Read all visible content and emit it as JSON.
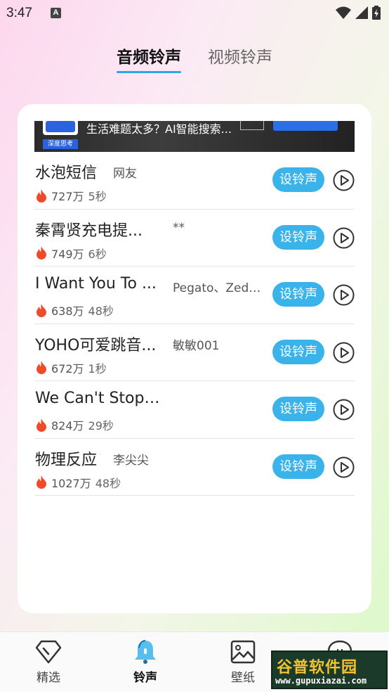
{
  "status_bar": {
    "time": "3:47",
    "notification_icon": "A"
  },
  "tabs": [
    {
      "label": "音频铃声",
      "active": true
    },
    {
      "label": "视频铃声",
      "active": false
    }
  ],
  "ad": {
    "logo_label": "深度思考",
    "text": "生活难题太多？AI智能搜索..."
  },
  "ringtones": [
    {
      "title": "水泡短信",
      "artist": "网友",
      "plays": "727万",
      "duration": "5秒",
      "button_label": "设铃声"
    },
    {
      "title": "秦霄贤充电提...",
      "artist": "**",
      "plays": "749万",
      "duration": "6秒",
      "button_label": "设铃声"
    },
    {
      "title": "I Want You To ...",
      "artist": "Pegato、Zedd...",
      "plays": "638万",
      "duration": "48秒",
      "button_label": "设铃声"
    },
    {
      "title": "YOHO可爱跳音...",
      "artist": "敏敏001",
      "plays": "672万",
      "duration": "1秒",
      "button_label": "设铃声"
    },
    {
      "title": "We Can't Stop (...",
      "artist": "",
      "plays": "824万",
      "duration": "29秒",
      "button_label": "设铃声"
    },
    {
      "title": "物理反应",
      "artist": "李尖尖",
      "plays": "1027万",
      "duration": "48秒",
      "button_label": "设铃声"
    }
  ],
  "bottom_nav": [
    {
      "label": "精选",
      "icon": "diamond-icon",
      "active": false
    },
    {
      "label": "铃声",
      "icon": "bell-icon",
      "active": true
    },
    {
      "label": "壁纸",
      "icon": "image-icon",
      "active": false
    },
    {
      "label": "",
      "icon": "chat-icon",
      "active": false
    }
  ],
  "watermark": {
    "brand": "谷普软件园",
    "url": "www.gupuxiazai.com"
  },
  "colors": {
    "accent": "#3ab3ea",
    "fire": "#f04a2a"
  }
}
